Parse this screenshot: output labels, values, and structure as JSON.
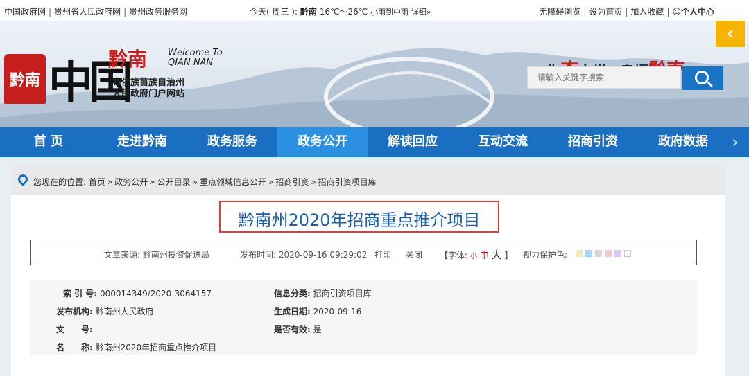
{
  "topbar": {
    "links": [
      "中国政府网",
      "贵州省人民政府网",
      "贵州政务服务网"
    ],
    "weather_prefix": "今天( 周三 ):",
    "weather_city": "黔南",
    "weather_temp": "16℃～26℃",
    "weather_desc": "小雨到中雨",
    "weather_more": "详细»",
    "right_links": [
      "无障碍浏览",
      "设为首页",
      "加入收藏"
    ],
    "user_center": "☺个人中心"
  },
  "banner": {
    "logo_big": "中国",
    "logo_qn": "黔南",
    "welcome_line1": "Welcome To",
    "welcome_line2": "QIAN NAN",
    "sub_line1": "布依族苗族自治州",
    "sub_line2": "人民政府门户网站",
    "slogan_a": "生",
    "slogan_red1": "态",
    "slogan_b": "之州 · 幸福",
    "slogan_red2": "黔南",
    "search_placeholder": "请输入关键字搜索",
    "collapse_glyph": "‹"
  },
  "nav": {
    "items": [
      "首 页",
      "走进黔南",
      "政务服务",
      "政务公开",
      "解读回应",
      "互动交流",
      "招商引资",
      "政府数据"
    ],
    "active_index": 3,
    "more_glyph": "›"
  },
  "breadcrumb": {
    "prefix": "您现在的位置:",
    "items": [
      "首页",
      "政务公开",
      "公开目录",
      "重点领域信息公开",
      "招商引资",
      "招商引资项目库"
    ],
    "separator": "»"
  },
  "article": {
    "title": "黔南州2020年招商重点推介项目",
    "source_label": "文章来源:",
    "source": "黔南州投资促进局",
    "time_label": "发布时间:",
    "time": "2020-09-16 09:29:02",
    "print": "打印",
    "close": "关闭",
    "font_label": "【字体:",
    "font_small": "小",
    "font_medium": "中",
    "font_large": "大",
    "font_end": "】",
    "eye_label": "视力保护色:",
    "eye_colors": [
      "#f5ecb5",
      "#a9d8f2",
      "#d6d6d6",
      "#f2c7d3",
      "#d9c9f2",
      "#ffffff"
    ]
  },
  "info": {
    "index_label": "索 引 号:",
    "index_value": "000014349/2020-3064157",
    "category_label": "信息分类:",
    "category_value": "招商引资项目库",
    "org_label": "发布机构:",
    "org_value": "黔南州人民政府",
    "date_label": "生成日期:",
    "date_value": "2020-09-16",
    "docno_label": "文　　号:",
    "docno_value": "",
    "valid_label": "是否有效:",
    "valid_value": "是",
    "name_label": "名　　称:",
    "name_value": "黔南州2020年招商重点推介项目"
  }
}
